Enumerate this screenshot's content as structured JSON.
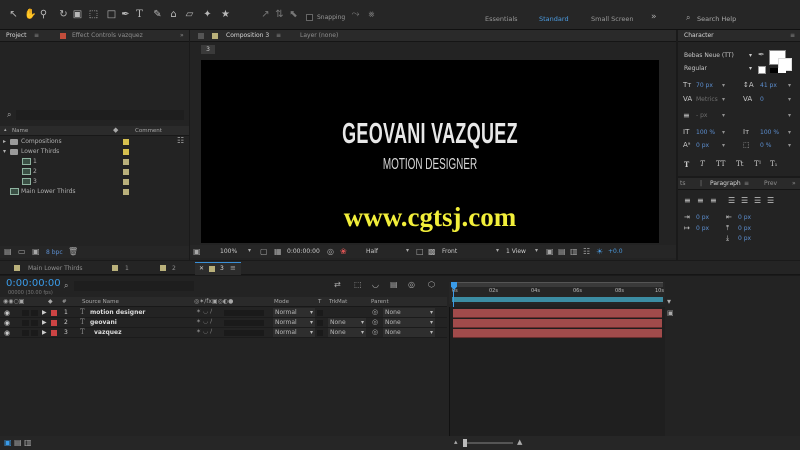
{
  "toolbar": {
    "snapping_label": "Snapping",
    "workspaces": [
      "Essentials",
      "Standard",
      "Small Screen"
    ],
    "active_workspace": "Standard",
    "search_placeholder": "Search Help"
  },
  "project_panel": {
    "tab_project": "Project",
    "tab_effect_controls": "Effect Controls  vazquez",
    "col_name": "Name",
    "col_comment": "Comment",
    "items": [
      {
        "name": "Compositions",
        "type": "folder",
        "depth": 0,
        "color": "#d6c04e"
      },
      {
        "name": "Lower Thirds",
        "type": "folder",
        "depth": 0,
        "color": "#d6c04e"
      },
      {
        "name": "1",
        "type": "comp",
        "depth": 1,
        "color": "#b9b07a"
      },
      {
        "name": "2",
        "type": "comp",
        "depth": 1,
        "color": "#b9b07a"
      },
      {
        "name": "3",
        "type": "comp",
        "depth": 1,
        "color": "#b9b07a"
      },
      {
        "name": "Main Lower Thirds",
        "type": "comp",
        "depth": 0,
        "color": "#b9b07a"
      }
    ],
    "bpc_label": "8 bpc"
  },
  "comp_panel": {
    "tab_composition": "Composition 3",
    "tab_layer": "Layer (none)",
    "breadcrumb": "3",
    "title_text": "GEOVANI VAZQUEZ",
    "subtitle_text": "MOTION DESIGNER",
    "watermark": "www.cgtsj.com",
    "zoom": "100%",
    "timecode": "0:00:00:00",
    "resolution": "Half",
    "view": "Front",
    "views": "1 View",
    "exposure": "+0.0"
  },
  "character_panel": {
    "title": "Character",
    "font": "Bebas Neue (TT)",
    "style": "Regular",
    "font_size": "70 px",
    "leading": "41 px",
    "kerning": "Metrics",
    "tracking": "0",
    "stroke_width": "- px",
    "v_scale": "100 %",
    "h_scale": "100 %",
    "baseline": "0 px",
    "tsume": "0 %",
    "style_buttons": [
      "T",
      "T",
      "TT",
      "Tt",
      "T¹",
      "T₁"
    ]
  },
  "paragraph_panel": {
    "tab_prev": "ts",
    "tab_paragraph": "Paragraph",
    "tab_next": "Prev",
    "values": [
      "0 px",
      "0 px",
      "0 px",
      "0 px",
      "0 px"
    ]
  },
  "timeline": {
    "tabs": [
      "Main Lower Thirds",
      "1",
      "2",
      "3"
    ],
    "active_tab": "3",
    "timecode": "0:00:00:00",
    "fps": "00000 (30.00 fps)",
    "col_source": "Source Name",
    "col_mode": "Mode",
    "col_t": "T",
    "col_trkmat": "TrkMat",
    "col_parent": "Parent",
    "ruler_marks": [
      "0s",
      "02s",
      "04s",
      "06s",
      "08s",
      "10s"
    ],
    "layers": [
      {
        "num": "1",
        "name": "motion designer",
        "mode": "Normal",
        "trkmat": "",
        "parent": "None"
      },
      {
        "num": "2",
        "name": "geovani",
        "mode": "Normal",
        "trkmat": "None",
        "parent": "None"
      },
      {
        "num": "3",
        "name": "vazquez",
        "mode": "Normal",
        "trkmat": "None",
        "parent": "None"
      }
    ]
  }
}
